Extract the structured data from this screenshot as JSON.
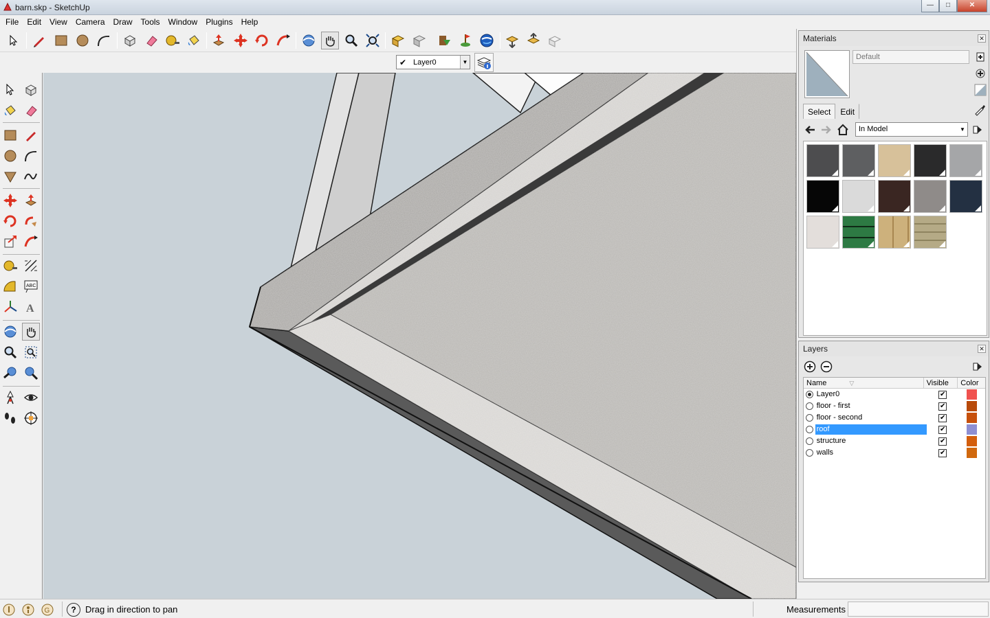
{
  "window": {
    "title": "barn.skp - SketchUp",
    "minimize": "—",
    "maximize": "□",
    "close": "✕"
  },
  "menu": [
    "File",
    "Edit",
    "View",
    "Camera",
    "Draw",
    "Tools",
    "Window",
    "Plugins",
    "Help"
  ],
  "layer_toolbar": {
    "current_layer": "Layer0",
    "check": "✔"
  },
  "materials": {
    "title": "Materials",
    "name_placeholder": "Default",
    "tabs": [
      "Select",
      "Edit"
    ],
    "collection": "In Model",
    "swatches": [
      {
        "name": "dark-gray",
        "color": "#4d4d4f"
      },
      {
        "name": "gray",
        "color": "#5e5f61"
      },
      {
        "name": "tan",
        "color": "#d7c19a"
      },
      {
        "name": "charcoal",
        "color": "#2a2a2b"
      },
      {
        "name": "light-gray",
        "color": "#a5a6a8"
      },
      {
        "name": "black",
        "color": "#060606"
      },
      {
        "name": "pale-gray",
        "color": "#dadada"
      },
      {
        "name": "dark-brown",
        "color": "#3a2622"
      },
      {
        "name": "granite",
        "color": "#8f8b89"
      },
      {
        "name": "navy",
        "color": "#233042"
      },
      {
        "name": "stucco",
        "color": "#e3dedb"
      },
      {
        "name": "green-siding",
        "color": "#2d7a43"
      },
      {
        "name": "wood-planks",
        "color": "#cdb17c"
      },
      {
        "name": "stone-bricks",
        "color": "#b5aa86"
      }
    ]
  },
  "layers": {
    "title": "Layers",
    "headers": {
      "name": "Name",
      "visible": "Visible",
      "color": "Color"
    },
    "rows": [
      {
        "name": "Layer0",
        "active": true,
        "visible": true,
        "color": "#f0524f",
        "selected": false
      },
      {
        "name": "floor - first",
        "active": false,
        "visible": true,
        "color": "#b84a0a",
        "selected": false
      },
      {
        "name": "floor - second",
        "active": false,
        "visible": true,
        "color": "#c7500b",
        "selected": false
      },
      {
        "name": "roof",
        "active": false,
        "visible": true,
        "color": "#8e8fd2",
        "selected": true
      },
      {
        "name": "structure",
        "active": false,
        "visible": true,
        "color": "#d35e0c",
        "selected": false
      },
      {
        "name": "walls",
        "active": false,
        "visible": true,
        "color": "#d0680e",
        "selected": false
      }
    ],
    "check": "✔"
  },
  "status": {
    "help": "?",
    "text": "Drag in direction to pan",
    "measurements_label": "Measurements"
  },
  "colors": {
    "viewport_bg": "#c9d2d8",
    "roof_texture": "#b9b7b3",
    "selection_blue": "#3399ff"
  }
}
